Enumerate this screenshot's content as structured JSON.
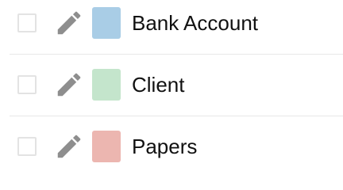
{
  "items": [
    {
      "label": "Bank Account",
      "color": "#a9cde6"
    },
    {
      "label": "Client",
      "color": "#c4e5cc"
    },
    {
      "label": "Papers",
      "color": "#ecb6b0"
    }
  ],
  "icons": {
    "checkbox": "checkbox-icon",
    "edit": "pencil-icon"
  },
  "colors": {
    "icon": "#8e8e8e",
    "checkbox_border": "#e3e3e3",
    "divider": "#e8e8e8"
  }
}
